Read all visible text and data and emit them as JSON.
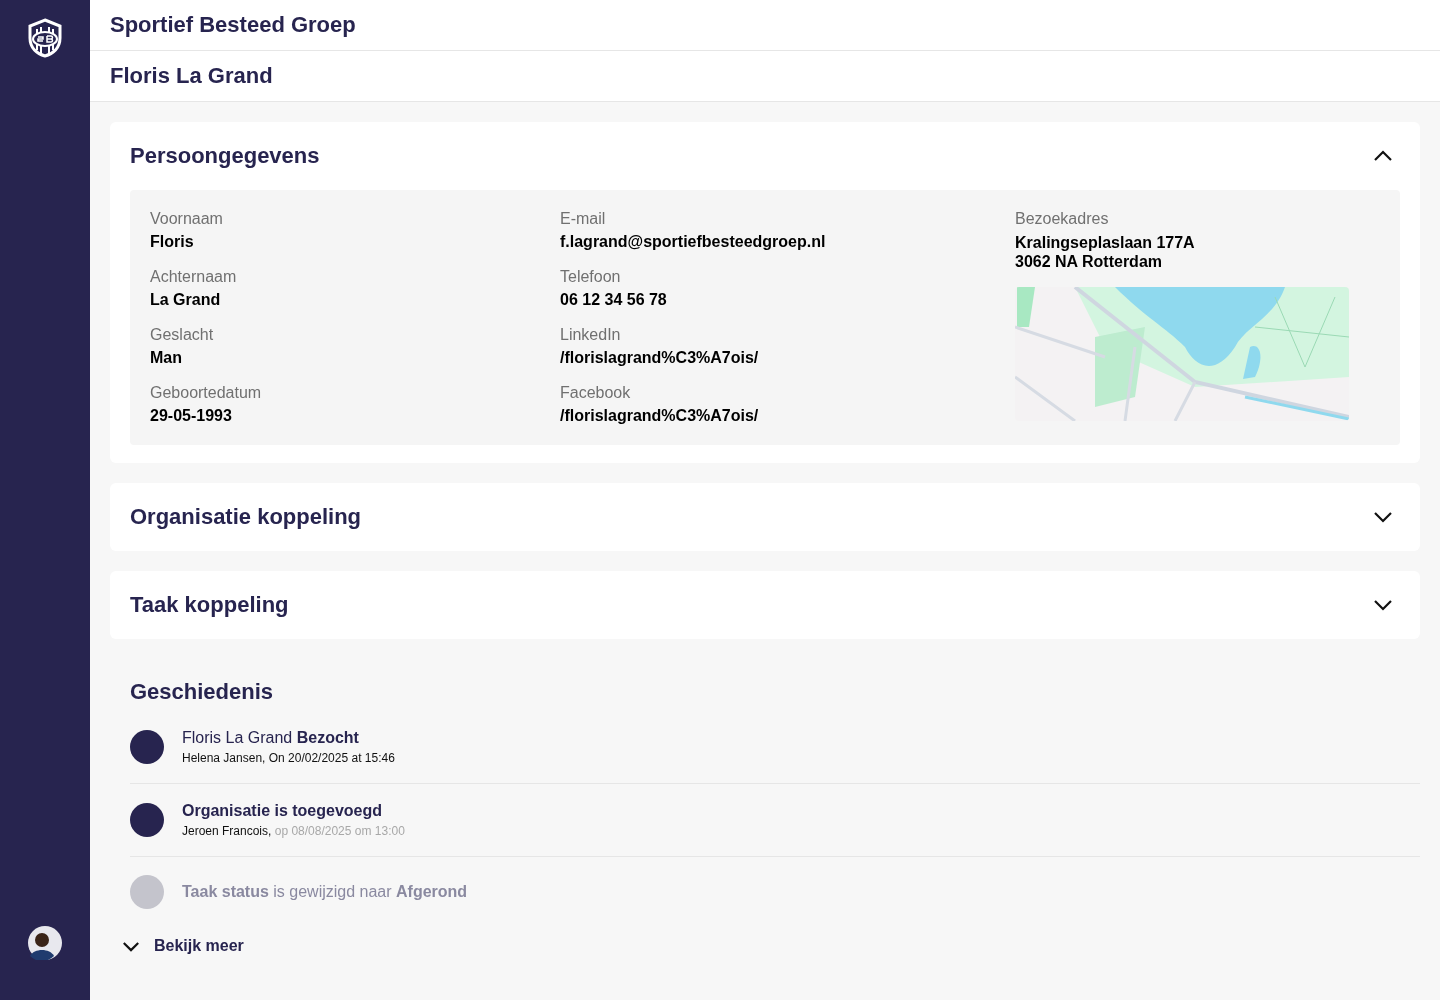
{
  "company": "Sportief Besteed Groep",
  "person": "Floris La Grand",
  "sections": [
    {
      "title": "Persoongegevens",
      "expanded": true,
      "columns": [
        [
          {
            "label": "Voornaam",
            "value": "Floris"
          },
          {
            "label": "Achternaam",
            "value": "La Grand"
          },
          {
            "label": "Geslacht",
            "value": "Man"
          },
          {
            "label": "Geboortedatum",
            "value": "29-05-1993"
          }
        ],
        [
          {
            "label": "E-mail",
            "value": "f.lagrand@sportiefbesteedgroep.nl"
          },
          {
            "label": "Telefoon",
            "value": "06 12 34 56 78"
          },
          {
            "label": "LinkedIn",
            "value": "/florislagrand%C3%A7ois/"
          },
          {
            "label": "Facebook",
            "value": "/florislagrand%C3%A7ois/"
          }
        ]
      ],
      "address": {
        "label": "Bezoekadres",
        "lines": [
          "Kralingseplaslaan 177A",
          "3062 NA Rotterdam"
        ],
        "map": {
          "kind": "picture"
        }
      }
    },
    {
      "title": "Organisatie koppeling",
      "expanded": false
    },
    {
      "title": "Taak koppeling",
      "expanded": false
    }
  ],
  "history": {
    "title": "Geschiedenis",
    "items": [
      {
        "title": "Floris La Grand **Bezocht**",
        "emphasis": false,
        "author": "Helena Jansen,",
        "time": "On 20/02/2025 at 15:46",
        "time_muted": false,
        "faded": false
      },
      {
        "title": "Organisatie is toegevoegd",
        "emphasis": true,
        "author": "Jeroen Francois,",
        "time": "op 08/08/2025 om 13:00",
        "time_muted": true,
        "faded": false
      },
      {
        "title": "**Taak status** is gewijzigd naar **Afgerond**",
        "emphasis": false,
        "faded": true
      }
    ],
    "more": "Bekijk meer"
  }
}
